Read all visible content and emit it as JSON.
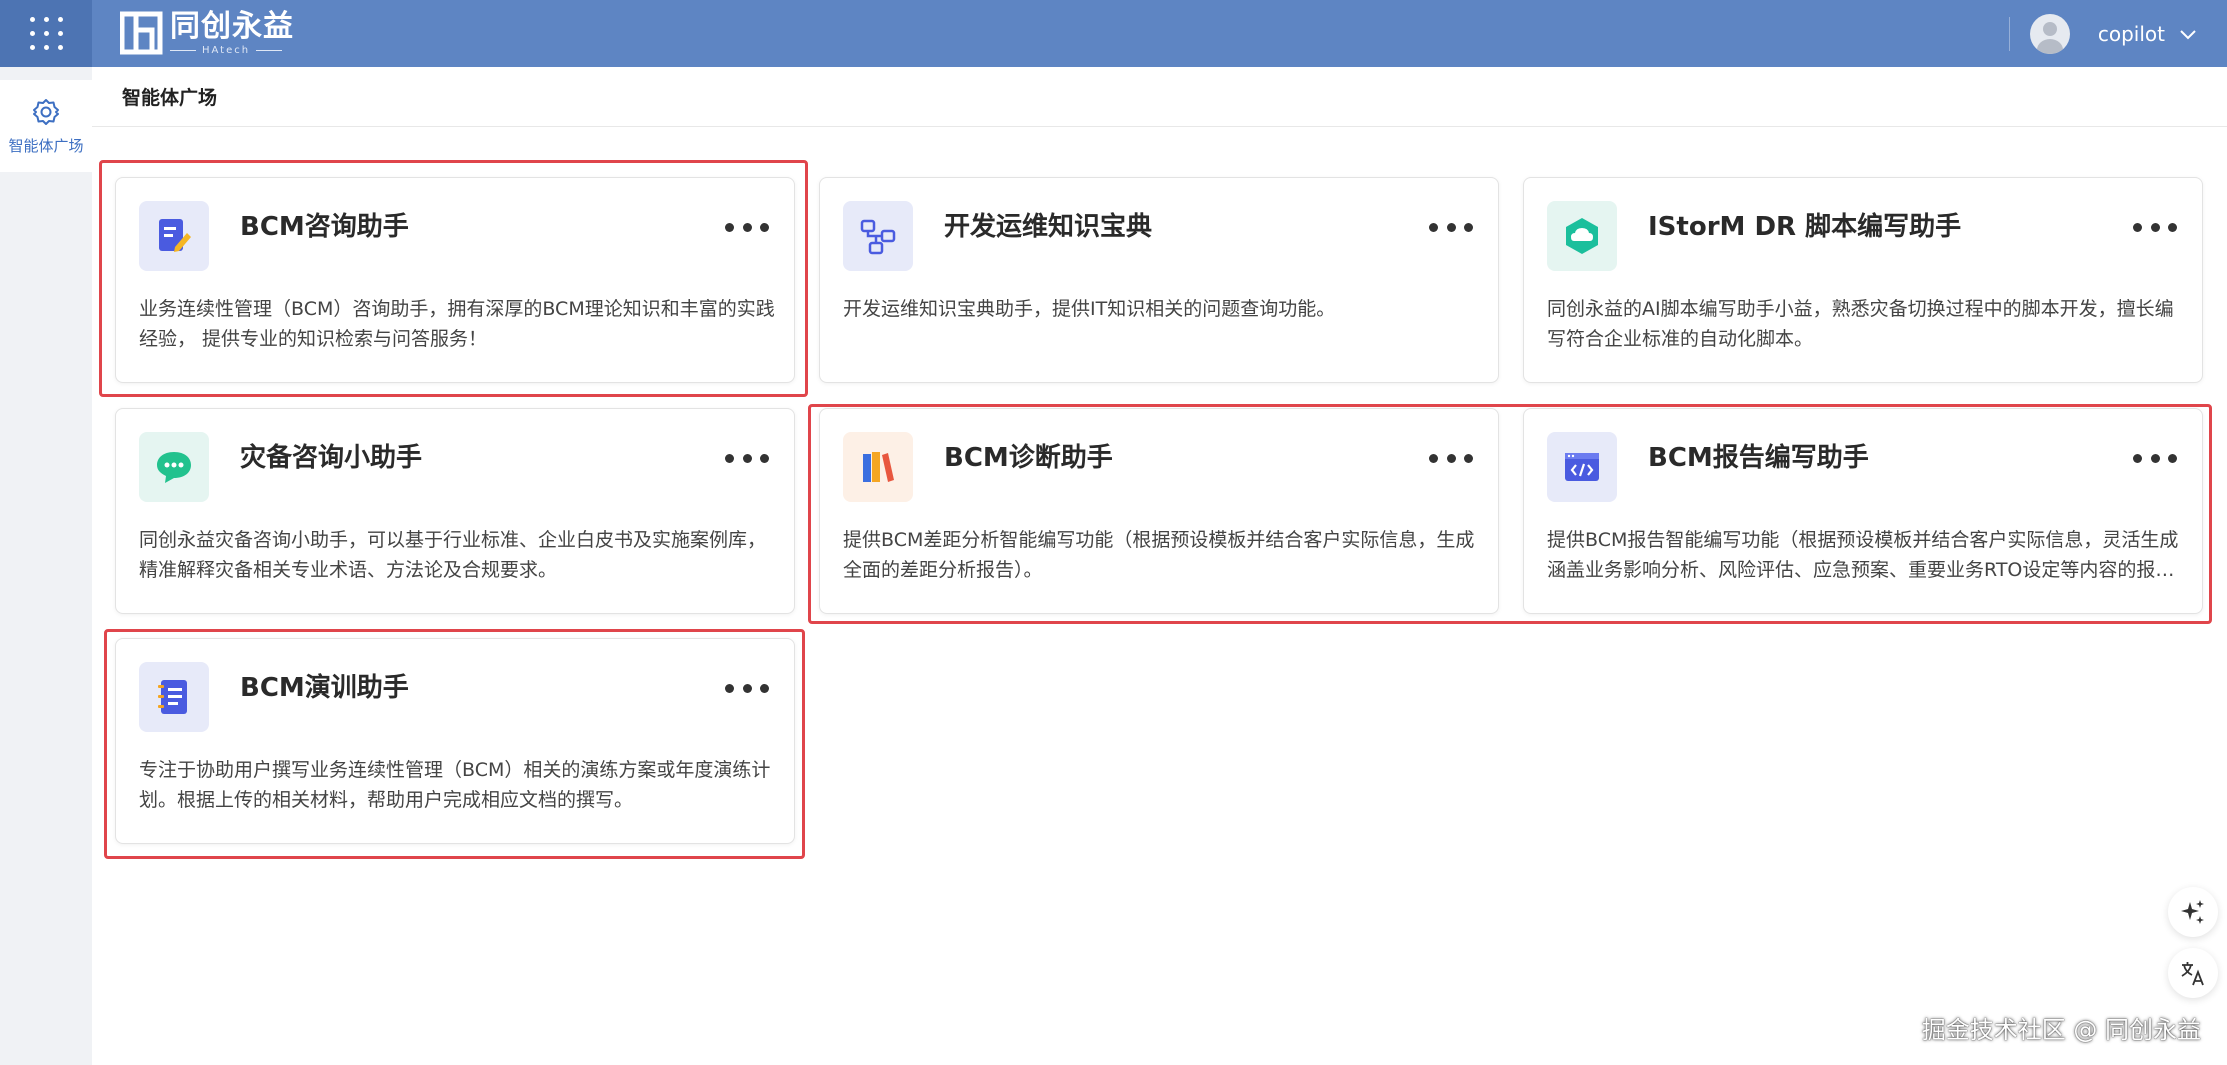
{
  "header": {
    "app_menu_icon": "grid-apps-icon",
    "logo_cn": "同创永益",
    "logo_en": "HAtech",
    "username": "copilot",
    "colors": {
      "bar": "#5e85c3",
      "apps_bg": "#4d74b3"
    }
  },
  "sidebar": {
    "items": [
      {
        "label": "智能体广场",
        "icon": "gear-icon"
      }
    ]
  },
  "main": {
    "breadcrumb": "智能体广场",
    "cards": [
      {
        "title": "BCM咨询助手",
        "icon": "document-edit-icon",
        "description": "业务连续性管理（BCM）咨询助手，拥有深厚的BCM理论知识和丰富的实践经验， 提供专业的知识检索与问答服务！"
      },
      {
        "title": "开发运维知识宝典",
        "icon": "flowchart-icon",
        "description": "开发运维知识宝典助手，提供IT知识相关的问题查询功能。"
      },
      {
        "title": "IStorM DR 脚本编写助手",
        "icon": "cloud-hexagon-icon",
        "description": "同创永益的AI脚本编写助手小益，熟悉灾备切换过程中的脚本开发，擅长编写符合企业标准的自动化脚本。"
      },
      {
        "title": "灾备咨询小助手",
        "icon": "chat-bubble-icon",
        "description": "同创永益灾备咨询小助手，可以基于行业标准、企业白皮书及实施案例库，精准解释灾备相关专业术语、方法论及合规要求。"
      },
      {
        "title": "BCM诊断助手",
        "icon": "books-icon",
        "description": "提供BCM差距分析智能编写功能（根据预设模板并结合客户实际信息，生成全面的差距分析报告）。"
      },
      {
        "title": "BCM报告编写助手",
        "icon": "code-window-icon",
        "description": "提供BCM报告智能编写功能（根据预设模板并结合客户实际信息，灵活生成涵盖业务影响分析、风险评估、应急预案、重要业务RTO设定等内容的报告）。"
      },
      {
        "title": "BCM演训助手",
        "icon": "notebook-icon",
        "description": "专注于协助用户撰写业务连续性管理（BCM）相关的演练方案或年度演练计划。根据上传的相关材料，帮助用户完成相应文档的撰写。"
      }
    ]
  },
  "floating": {
    "ai_icon": "sparkle-icon",
    "translate_icon": "translate-icon"
  },
  "watermark": "掘金技术社区 @ 同创永益",
  "annotation_color": "#e0454b"
}
